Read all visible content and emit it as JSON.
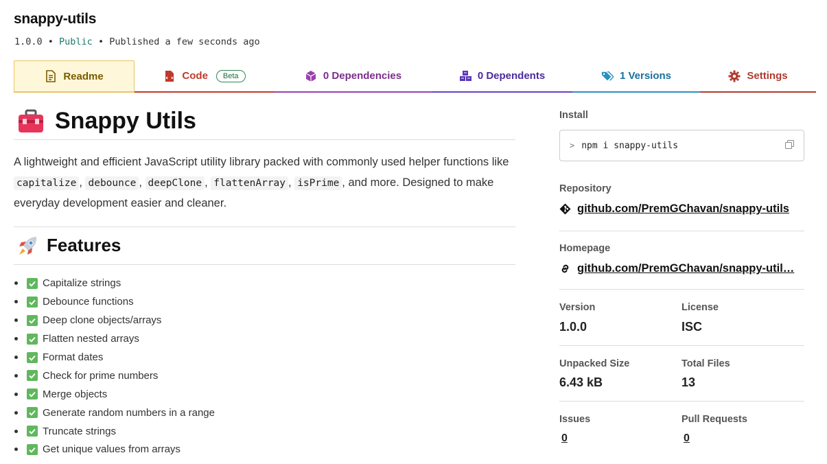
{
  "package": {
    "name": "snappy-utils",
    "version": "1.0.0",
    "visibility": "Public",
    "published": "Published a few seconds ago"
  },
  "tabs": [
    {
      "label": "Readme",
      "icon": "document-icon"
    },
    {
      "label": "Code",
      "icon": "code-file-icon",
      "badge": "Beta"
    },
    {
      "label": "0 Dependencies",
      "icon": "box-icon"
    },
    {
      "label": "0 Dependents",
      "icon": "boxes-icon"
    },
    {
      "label": "1 Versions",
      "icon": "tags-icon"
    },
    {
      "label": "Settings",
      "icon": "gear-icon"
    }
  ],
  "readme": {
    "title": "Snappy Utils",
    "intro_start": "A lightweight and efficient JavaScript utility library packed with commonly used helper functions like ",
    "codes": [
      "capitalize",
      "debounce",
      "deepClone",
      "flattenArray",
      "isPrime"
    ],
    "sep": ", ",
    "intro_mid": ", and more. Designed to make everyday development easier and cleaner.",
    "features_title": "Features",
    "features": [
      "Capitalize strings",
      "Debounce functions",
      "Deep clone objects/arrays",
      "Flatten nested arrays",
      "Format dates",
      "Check for prime numbers",
      "Merge objects",
      "Generate random numbers in a range",
      "Truncate strings",
      "Get unique values from arrays"
    ]
  },
  "sidebar": {
    "install_label": "Install",
    "install_cmd": "npm i snappy-utils",
    "repository_label": "Repository",
    "repository_link": "github.com/PremGChavan/snappy-utils",
    "homepage_label": "Homepage",
    "homepage_link": "github.com/PremGChavan/snappy-util…",
    "version_label": "Version",
    "version_value": "1.0.0",
    "license_label": "License",
    "license_value": "ISC",
    "unpacked_label": "Unpacked Size",
    "unpacked_value": "6.43 kB",
    "files_label": "Total Files",
    "files_value": "13",
    "issues_label": "Issues",
    "issues_value": "0",
    "prs_label": "Pull Requests",
    "prs_value": "0"
  },
  "colors": {
    "public": "#1d7a6a",
    "readme_tab_bg": "#fff7d9",
    "check_green": "#5fb85c"
  }
}
